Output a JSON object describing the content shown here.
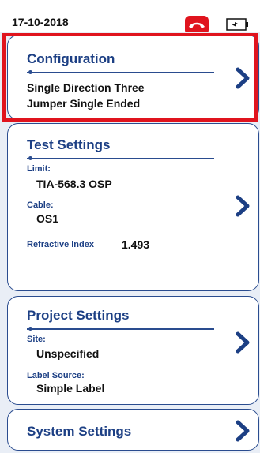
{
  "status": {
    "date": "17-10-2018",
    "icons": [
      "hang-up-phone-icon",
      "battery-icon"
    ],
    "accent_red": "#e0141e"
  },
  "configuration": {
    "title": "Configuration",
    "line1": "Single Direction Three",
    "line2": "Jumper Single Ended",
    "highlighted": true
  },
  "test_settings": {
    "title": "Test Settings",
    "limit_label": "Limit:",
    "limit_value": "TIA-568.3 OSP",
    "cable_label": "Cable:",
    "cable_value": "OS1",
    "ri_label": "Refractive Index",
    "ri_value": "1.493"
  },
  "project_settings": {
    "title": "Project Settings",
    "site_label": "Site:",
    "site_value": "Unspecified",
    "label_source_label": "Label Source:",
    "label_source_value": "Simple Label"
  },
  "system_settings": {
    "title": "System Settings"
  },
  "theme": {
    "accent_blue": "#1c3f84",
    "background": "#e9eef6"
  }
}
